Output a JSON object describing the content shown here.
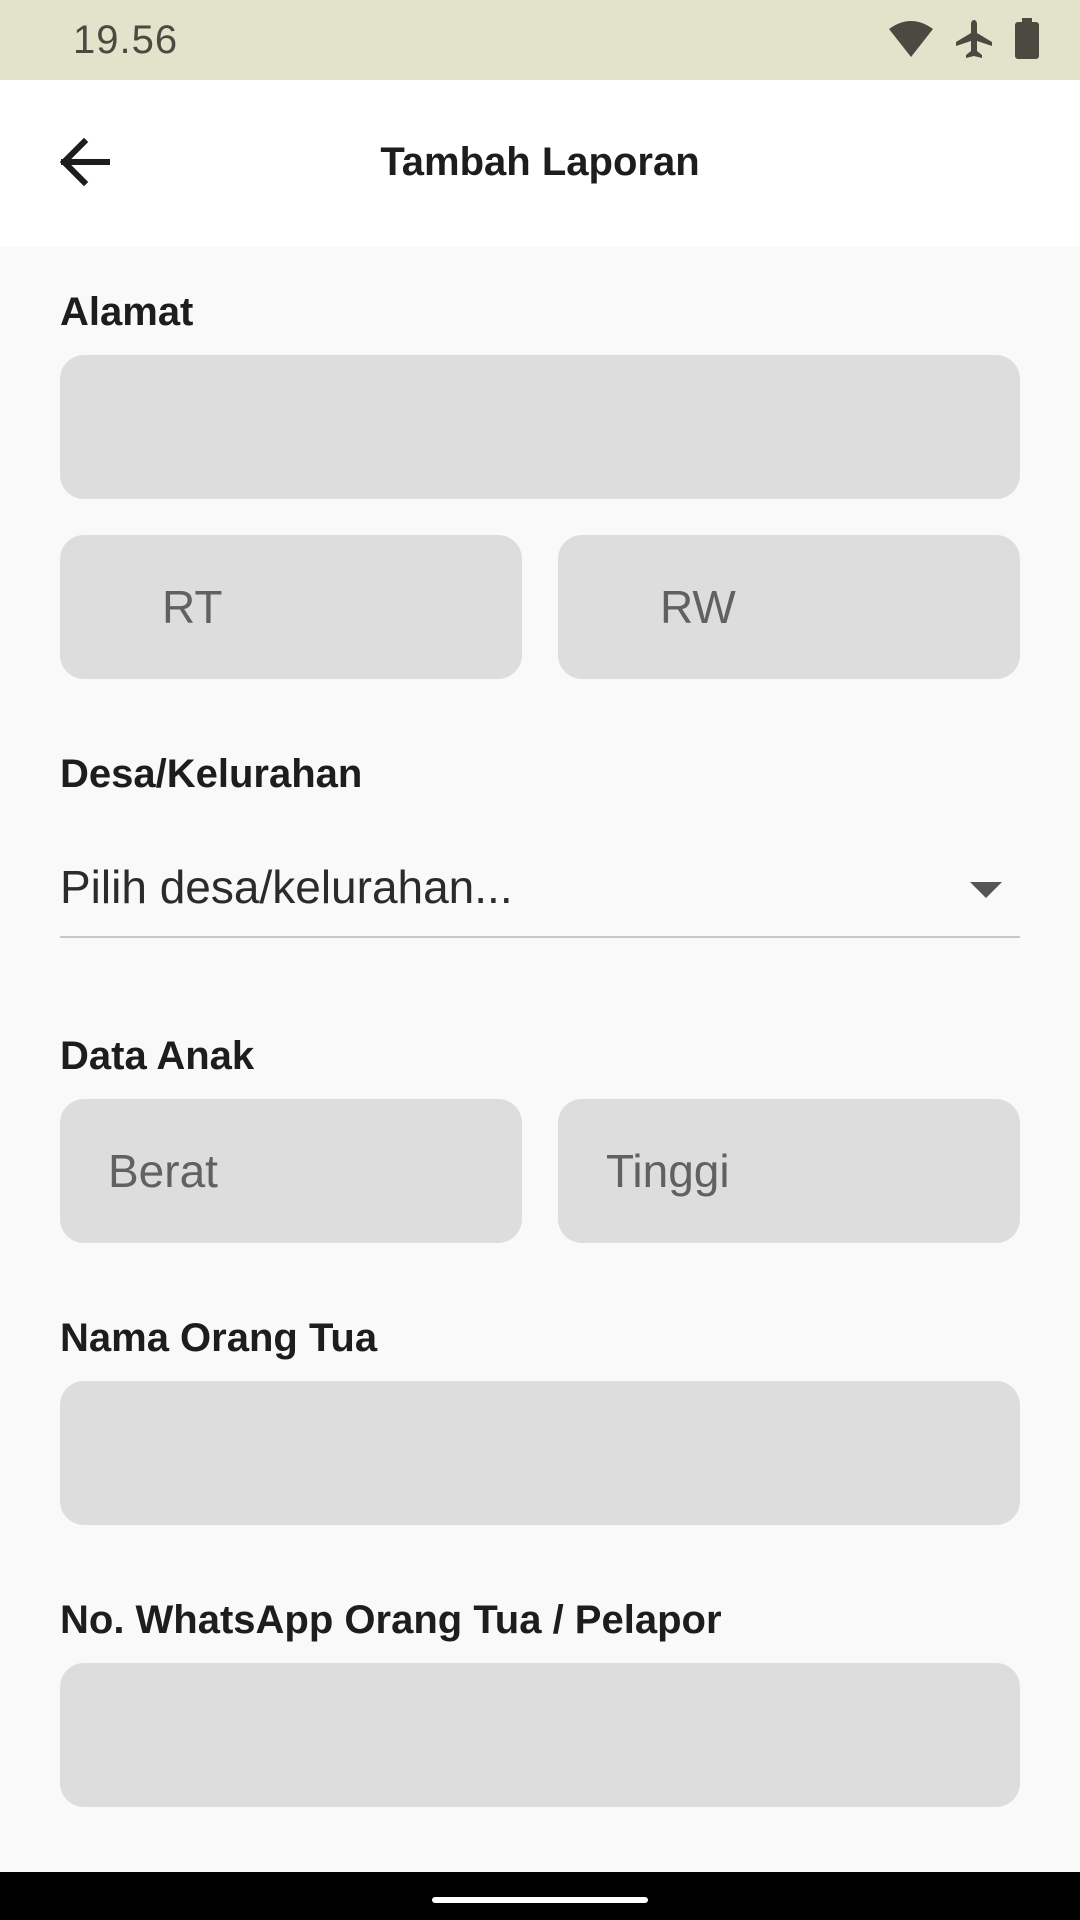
{
  "status_bar": {
    "time": "19.56",
    "icons": [
      "wifi-icon",
      "airplane-icon",
      "battery-icon"
    ]
  },
  "app_bar": {
    "title": "Tambah Laporan",
    "back_icon": "arrow-left-icon"
  },
  "form": {
    "alamat": {
      "label": "Alamat",
      "value": "",
      "placeholder": ""
    },
    "rt": {
      "placeholder": "RT",
      "value": ""
    },
    "rw": {
      "placeholder": "RW",
      "value": ""
    },
    "desa": {
      "label": "Desa/Kelurahan",
      "selected": "Pilih desa/kelurahan..."
    },
    "data_anak": {
      "label": "Data Anak",
      "berat": {
        "placeholder": "Berat",
        "value": ""
      },
      "tinggi": {
        "placeholder": "Tinggi",
        "value": ""
      }
    },
    "nama_orang_tua": {
      "label": "Nama Orang Tua",
      "value": ""
    },
    "whatsapp": {
      "label": "No. WhatsApp Orang Tua / Pelapor",
      "value": ""
    }
  },
  "colors": {
    "status_bar_bg": "#e3e3cb",
    "field_bg": "#dddddd",
    "page_bg": "#f9f9f9"
  }
}
